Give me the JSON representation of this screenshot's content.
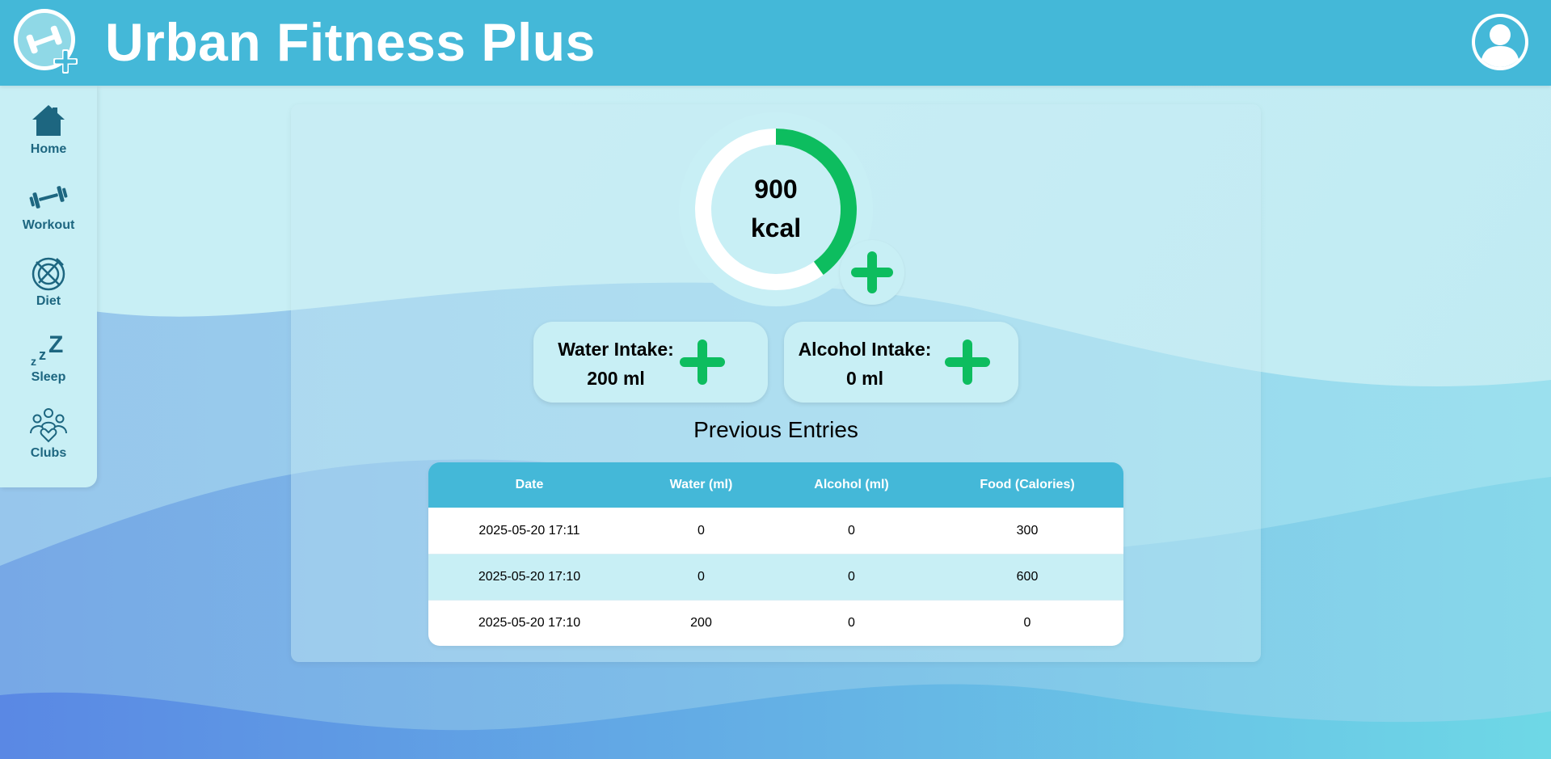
{
  "header": {
    "title": "Urban Fitness Plus",
    "logo_icon": "dumbbell-plus-logo-icon",
    "avatar_icon": "user-avatar-icon"
  },
  "sidebar": {
    "items": [
      {
        "label": "Home",
        "icon": "home-icon"
      },
      {
        "label": "Workout",
        "icon": "dumbbell-icon"
      },
      {
        "label": "Diet",
        "icon": "plate-cutlery-icon"
      },
      {
        "label": "Sleep",
        "icon": "zzz-icon"
      },
      {
        "label": "Clubs",
        "icon": "people-heart-icon"
      }
    ]
  },
  "calories": {
    "value": "900",
    "unit": "kcal",
    "progress_fraction": 0.4
  },
  "water": {
    "label": "Water Intake:",
    "value": "200 ml"
  },
  "alcohol": {
    "label": "Alcohol Intake:",
    "value": "0 ml"
  },
  "entries": {
    "title": "Previous Entries",
    "columns": [
      "Date",
      "Water (ml)",
      "Alcohol (ml)",
      "Food (Calories)"
    ],
    "rows": [
      [
        "2025-05-20 17:11",
        "0",
        "0",
        "300"
      ],
      [
        "2025-05-20 17:10",
        "0",
        "0",
        "600"
      ],
      [
        "2025-05-20 17:10",
        "200",
        "0",
        "0"
      ]
    ]
  },
  "colors": {
    "header": "#44b8d8",
    "accent_green": "#0dbd5f",
    "nav_text": "#1d6680",
    "card_bg": "#c8eff5"
  }
}
